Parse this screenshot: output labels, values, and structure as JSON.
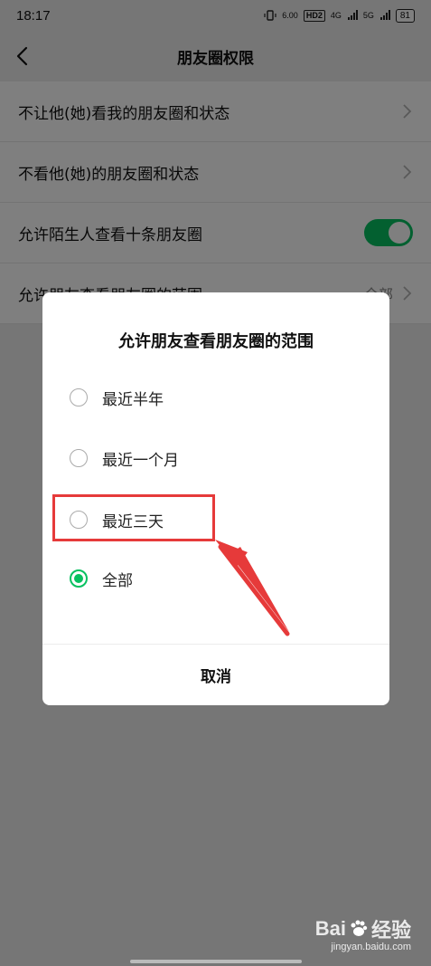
{
  "status_bar": {
    "time": "18:17",
    "net_speed": "6.00",
    "hd_label": "HD2",
    "signal_4g": "4G",
    "signal_5g": "5G",
    "battery": "81"
  },
  "header": {
    "title": "朋友圈权限"
  },
  "settings": {
    "rows": [
      {
        "label": "不让他(她)看我的朋友圈和状态"
      },
      {
        "label": "不看他(她)的朋友圈和状态"
      },
      {
        "label": "允许陌生人查看十条朋友圈",
        "toggle_on": true
      },
      {
        "label": "允许朋友查看朋友圈的范围",
        "value": "全部"
      }
    ]
  },
  "dialog": {
    "title": "允许朋友查看朋友圈的范围",
    "options": [
      {
        "label": "最近半年",
        "selected": false
      },
      {
        "label": "最近一个月",
        "selected": false
      },
      {
        "label": "最近三天",
        "selected": false
      },
      {
        "label": "全部",
        "selected": true
      }
    ],
    "cancel_label": "取消"
  },
  "annotation": {
    "color": "#e63a3a"
  },
  "watermark": {
    "brand": "Bai",
    "brand_suffix": "经验",
    "url": "jingyan.baidu.com"
  },
  "colors": {
    "accent": "#07c160"
  }
}
